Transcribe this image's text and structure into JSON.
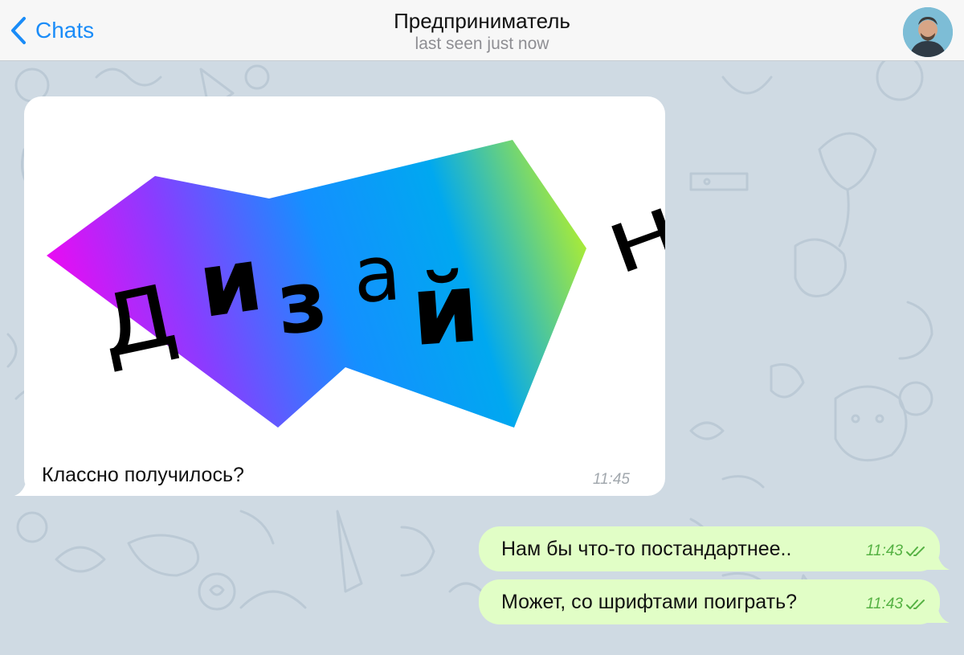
{
  "header": {
    "back_label": "Chats",
    "title": "Предприниматель",
    "subtitle": "last seen just now"
  },
  "messages": [
    {
      "direction": "incoming",
      "image_text": "дизайн",
      "caption": "Классно получилось?",
      "time": "11:45"
    },
    {
      "direction": "outgoing",
      "text": "Нам бы что-то постандартнее..",
      "time": "11:43",
      "status": "read"
    },
    {
      "direction": "outgoing",
      "text": "Может, со шрифтами поиграть?",
      "time": "11:43",
      "status": "read"
    }
  ],
  "image_letters": [
    "д",
    "и",
    "з",
    "а",
    "й",
    "н"
  ],
  "colors": {
    "accent": "#1a8cf8",
    "outgoing_bubble": "#e1fec6",
    "outgoing_time": "#56b244",
    "wallpaper": "#cfdae3",
    "gradient": [
      "#ff00f0",
      "#8a3cff",
      "#1490ff",
      "#00a8f0",
      "#dcff00"
    ]
  }
}
